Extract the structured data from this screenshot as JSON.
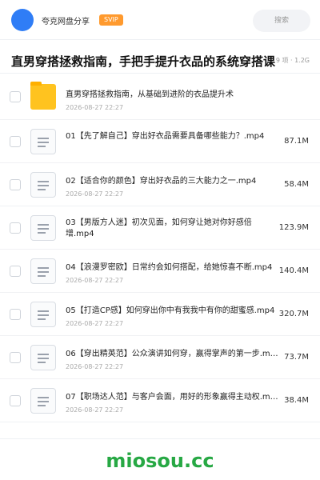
{
  "header": {
    "share_title": "夸克网盘分享",
    "badge": "SVIP",
    "search_label": "搜索"
  },
  "banner": {
    "title": "直男穿搭拯救指南，手把手提升衣品的系统穿搭课",
    "meta": "9 项 · 1.2G"
  },
  "files": [
    {
      "type": "folder",
      "name": "直男穿搭拯救指南，从基础到进阶的衣品提升术",
      "date": "2026-08-27 22:27",
      "size": ""
    },
    {
      "type": "doc",
      "name": "01【先了解自己】穿出好衣品需要具备哪些能力？.mp4",
      "date": "2026-08-27 22:27",
      "size": "87.1M"
    },
    {
      "type": "doc",
      "name": "02【适合你的颜色】穿出好衣品的三大能力之一.mp4",
      "date": "2026-08-27 22:27",
      "size": "58.4M"
    },
    {
      "type": "doc",
      "name": "03【男版方人迷】初次见面，如何穿让她对你好感倍增.mp4",
      "date": "2026-08-27 22:27",
      "size": "123.9M"
    },
    {
      "type": "doc",
      "name": "04【浪漫罗密欧】日常约会如何搭配，给她惊喜不断.mp4",
      "date": "2026-08-27 22:27",
      "size": "140.4M"
    },
    {
      "type": "doc",
      "name": "05【打造CP感】如何穿出你中有我我中有你的甜蜜感.mp4",
      "date": "2026-08-27 22:27",
      "size": "320.7M"
    },
    {
      "type": "doc",
      "name": "06【穿出精英范】公众演讲如何穿，赢得掌声的第一步.mp4",
      "date": "2026-08-27 22:27",
      "size": "73.7M"
    },
    {
      "type": "doc",
      "name": "07【职场达人范】与客户会面，用好的形象赢得主动权.mp4",
      "date": "2026-08-27 22:27",
      "size": "38.4M"
    }
  ],
  "watermark": "miosou.cc"
}
